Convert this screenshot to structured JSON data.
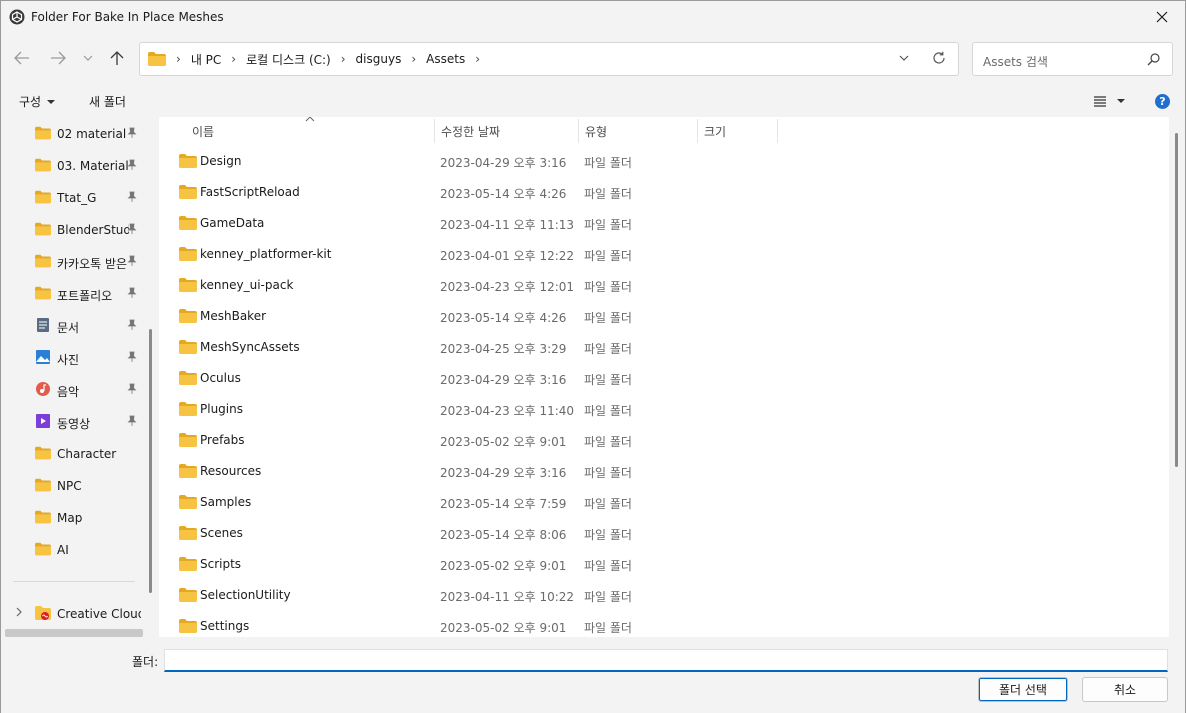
{
  "window": {
    "title": "Folder For Bake In Place Meshes"
  },
  "address": {
    "crumbs": [
      "내 PC",
      "로컬 디스크 (C:)",
      "disguys",
      "Assets"
    ]
  },
  "search": {
    "placeholder": "Assets 검색"
  },
  "toolbar": {
    "organize_label": "구성",
    "new_folder_label": "새 폴더",
    "help_label": "?"
  },
  "sidebar": {
    "items": [
      {
        "label": "02 material",
        "icon": "folder-icon",
        "pinned": true
      },
      {
        "label": "03. Material",
        "icon": "folder-icon",
        "pinned": true
      },
      {
        "label": "Ttat_G",
        "icon": "folder-icon",
        "pinned": true
      },
      {
        "label": "BlenderStudy",
        "icon": "folder-icon",
        "pinned": true
      },
      {
        "label": "카카오톡 받은",
        "icon": "folder-icon",
        "pinned": true
      },
      {
        "label": "포트폴리오",
        "icon": "folder-icon",
        "pinned": true
      },
      {
        "label": "문서",
        "icon": "document-icon",
        "pinned": true
      },
      {
        "label": "사진",
        "icon": "picture-icon",
        "pinned": true
      },
      {
        "label": "음악",
        "icon": "music-icon",
        "pinned": true
      },
      {
        "label": "동영상",
        "icon": "video-icon",
        "pinned": true
      },
      {
        "label": "Character",
        "icon": "folder-icon",
        "pinned": false
      },
      {
        "label": "NPC",
        "icon": "folder-icon",
        "pinned": false
      },
      {
        "label": "Map",
        "icon": "folder-icon",
        "pinned": false
      },
      {
        "label": "AI",
        "icon": "folder-icon",
        "pinned": false
      }
    ],
    "cloud": {
      "label": "Creative Cloud",
      "icon": "creative-cloud-icon"
    }
  },
  "columns": {
    "name": "이름",
    "modified": "수정한 날짜",
    "type": "유형",
    "size": "크기"
  },
  "files": [
    {
      "name": "Design",
      "modified": "2023-04-29 오후 3:16",
      "type": "파일 폴더"
    },
    {
      "name": "FastScriptReload",
      "modified": "2023-05-14 오후 4:26",
      "type": "파일 폴더"
    },
    {
      "name": "GameData",
      "modified": "2023-04-11 오후 11:13",
      "type": "파일 폴더"
    },
    {
      "name": "kenney_platformer-kit",
      "modified": "2023-04-01 오후 12:22",
      "type": "파일 폴더"
    },
    {
      "name": "kenney_ui-pack",
      "modified": "2023-04-23 오후 12:01",
      "type": "파일 폴더"
    },
    {
      "name": "MeshBaker",
      "modified": "2023-05-14 오후 4:26",
      "type": "파일 폴더"
    },
    {
      "name": "MeshSyncAssets",
      "modified": "2023-04-25 오후 3:29",
      "type": "파일 폴더"
    },
    {
      "name": "Oculus",
      "modified": "2023-04-29 오후 3:16",
      "type": "파일 폴더"
    },
    {
      "name": "Plugins",
      "modified": "2023-04-23 오후 11:40",
      "type": "파일 폴더"
    },
    {
      "name": "Prefabs",
      "modified": "2023-05-02 오후 9:01",
      "type": "파일 폴더"
    },
    {
      "name": "Resources",
      "modified": "2023-04-29 오후 3:16",
      "type": "파일 폴더"
    },
    {
      "name": "Samples",
      "modified": "2023-05-14 오후 7:59",
      "type": "파일 폴더"
    },
    {
      "name": "Scenes",
      "modified": "2023-05-14 오후 8:06",
      "type": "파일 폴더"
    },
    {
      "name": "Scripts",
      "modified": "2023-05-02 오후 9:01",
      "type": "파일 폴더"
    },
    {
      "name": "SelectionUtility",
      "modified": "2023-04-11 오후 10:22",
      "type": "파일 폴더"
    },
    {
      "name": "Settings",
      "modified": "2023-05-02 오후 9:01",
      "type": "파일 폴더"
    }
  ],
  "footer": {
    "folder_label": "폴더:",
    "folder_value": "",
    "select_label": "폴더 선택",
    "cancel_label": "취소"
  },
  "colors": {
    "accent": "#0067c0",
    "folder": "#f6c343",
    "folder_dark": "#e5a823",
    "help": "#1e6fd0"
  }
}
